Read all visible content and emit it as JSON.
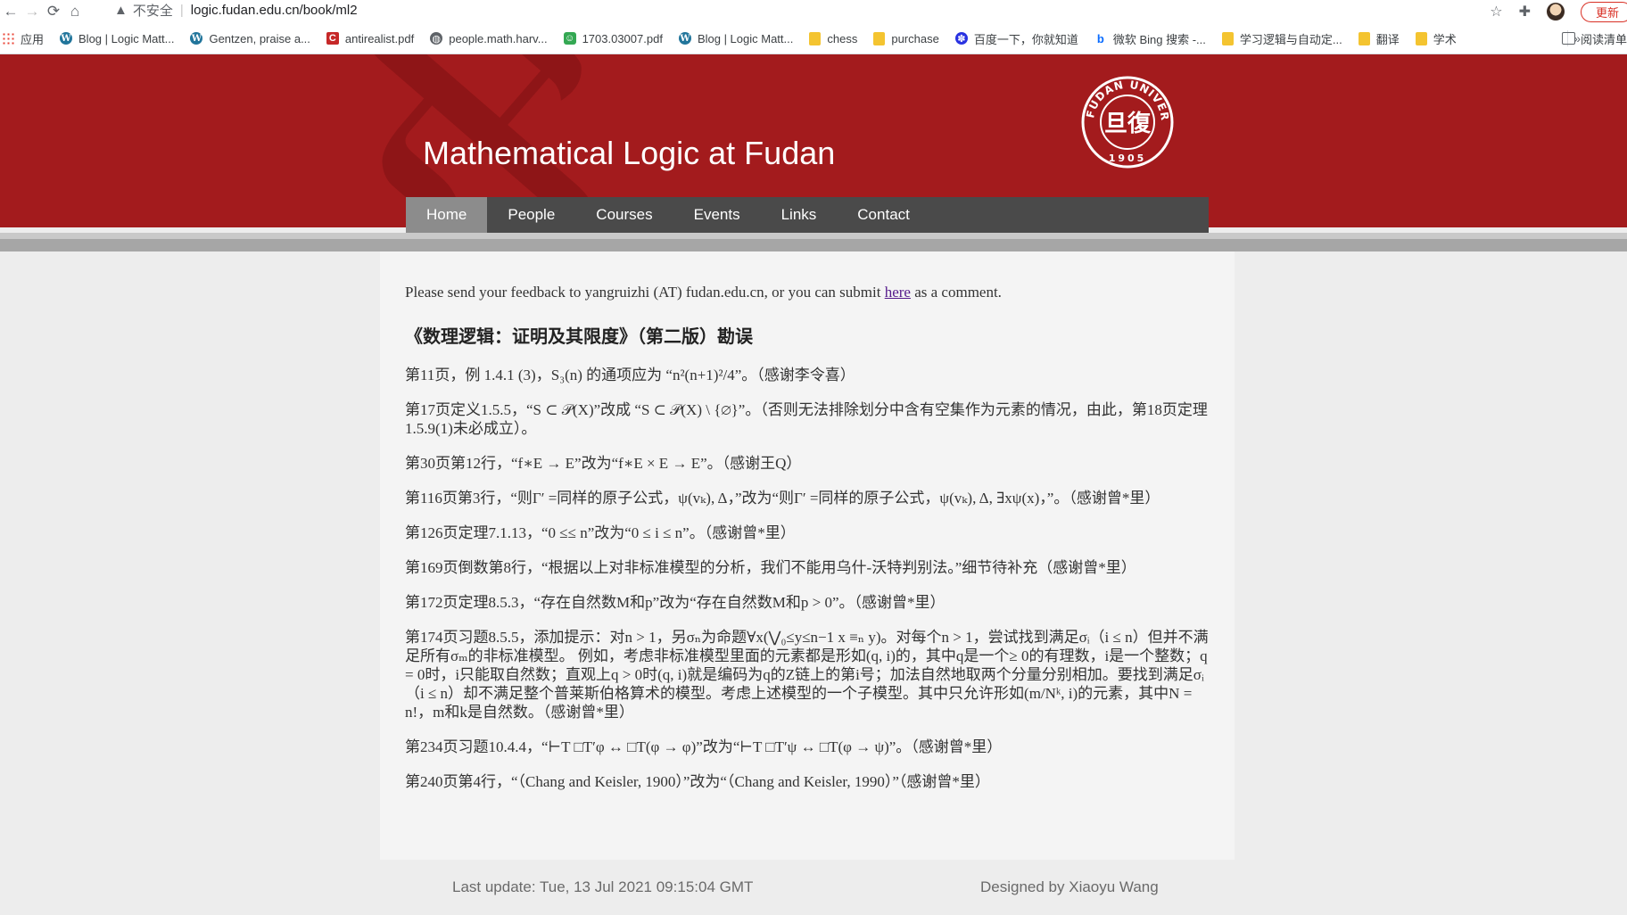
{
  "browser": {
    "insecure_label": "不安全",
    "url": "logic.fudan.edu.cn/book/ml2",
    "update_label": "更新",
    "bookmarks": [
      {
        "label": "应用",
        "icon": "apps-icon"
      },
      {
        "label": "Blog | Logic Matt...",
        "icon": "wordpress-icon"
      },
      {
        "label": "Gentzen, praise a...",
        "icon": "wordpress-icon"
      },
      {
        "label": "antirealist.pdf",
        "icon": "c-icon"
      },
      {
        "label": "people.math.harv...",
        "icon": "globe-icon"
      },
      {
        "label": "1703.03007.pdf",
        "icon": "green-icon"
      },
      {
        "label": "Blog | Logic Matt...",
        "icon": "wordpress-icon"
      },
      {
        "label": "chess",
        "icon": "folder-icon"
      },
      {
        "label": "purchase",
        "icon": "folder-icon"
      },
      {
        "label": "百度一下，你就知道",
        "icon": "baidu-icon"
      },
      {
        "label": "微软 Bing 搜索 -...",
        "icon": "bing-icon"
      },
      {
        "label": "学习逻辑与自动定...",
        "icon": "folder-icon"
      },
      {
        "label": "翻译",
        "icon": "folder-icon"
      },
      {
        "label": "学术",
        "icon": "folder-icon"
      }
    ],
    "more_label": "»",
    "reading_list_label": "阅读清单"
  },
  "site": {
    "title": "Mathematical Logic at Fudan",
    "logo": {
      "top_text": "FUDAN UNIVERSITY",
      "year": "1905",
      "center": "旦復"
    },
    "brand_color": "#a31b1d",
    "nav": [
      "Home",
      "People",
      "Courses",
      "Events",
      "Links",
      "Contact"
    ],
    "active_nav": "Home"
  },
  "content": {
    "feedback_before": "Please send your feedback to yangruizhi (AT) fudan.edu.cn, or you can submit ",
    "feedback_link": "here",
    "feedback_after": " as a comment.",
    "heading": "《数理逻辑：证明及其限度》（第二版）勘误",
    "entries": [
      "第11页，例 1.4.1 (3)，S₃(n) 的通项应为 “n²(n+1)²/4”。（感谢李令喜）",
      "第17页定义1.5.5，“S ⊂ 𝒫(X)”改成 “S ⊂ 𝒫(X) \\ {∅}”。（否则无法排除划分中含有空集作为元素的情况，由此，第18页定理1.5.9(1)未必成立）。",
      "第30页第12行，“f∗E → E”改为“f∗E × E → E”。（感谢王Q）",
      "第116页第3行，“则Γ′ =同样的原子公式，ψ(vₖ), Δ，”改为“则Γ′ =同样的原子公式，ψ(vₖ), Δ, ∃xψ(x)，”。（感谢曾*里）",
      "第126页定理7.1.13，“0 ≤≤ n”改为“0 ≤ i ≤ n”。（感谢曾*里）",
      "第169页倒数第8行，“根据以上对非标准模型的分析，我们不能用乌什-沃特判别法。”细节待补充（感谢曾*里）",
      "第172页定理8.5.3，“存在自然数M和p”改为“存在自然数M和p > 0”。（感谢曾*里）",
      "第174页习题8.5.5，添加提示：对n > 1，另σₙ为命题∀x(⋁₀≤y≤n−1 x ≡ₙ y)。对每个n > 1，尝试找到满足σᵢ（i ≤ n）但并不满足所有σₘ的非标准模型。 例如，考虑非标准模型里面的元素都是形如(q, i)的，其中q是一个≥ 0的有理数，i是一个整数；q = 0时，i只能取自然数；直观上q > 0时(q, i)就是编码为q的Z链上的第i号；加法自然地取两个分量分别相加。要找到满足σᵢ（i ≤ n）却不满足整个普莱斯伯格算术的模型。考虑上述模型的一个子模型。其中只允许形如(m/Nᵏ, i)的元素，其中N = n!，m和k是自然数。（感谢曾*里）",
      "第234页习题10.4.4，“⊢T □T′φ ↔ □T(φ → φ)”改为“⊢T □T′ψ ↔ □T(φ → ψ)”。（感谢曾*里）",
      "第240页第4行，“（Chang and Keisler, 1900）”改为“（Chang and Keisler, 1990）”（感谢曾*里）"
    ]
  },
  "footer": {
    "last_update": "Last update: Tue, 13 Jul 2021 09:15:04 GMT",
    "designer": "Designed by Xiaoyu Wang"
  }
}
